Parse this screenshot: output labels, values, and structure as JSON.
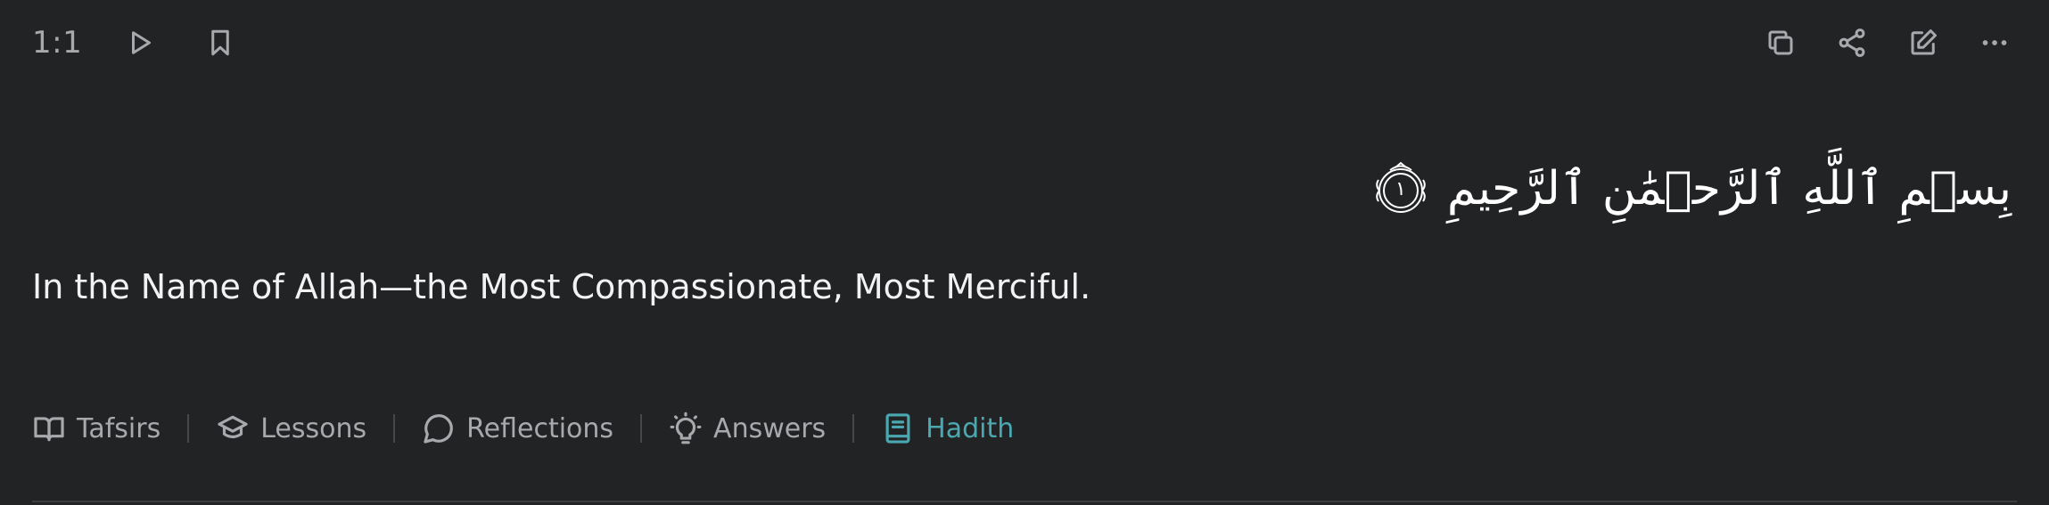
{
  "verse": {
    "key": "1:1",
    "arabic_text": "بِسۡمِ ٱللَّهِ ٱلرَّحۡمَٰنِ ٱلرَّحِيمِ",
    "ayah_number": "١",
    "translation": "In the Name of Allah—the Most Compassionate, Most Merciful."
  },
  "toolbar": {
    "play_icon": "play-icon",
    "bookmark_icon": "bookmark-icon",
    "copy_icon": "copy-icon",
    "share_icon": "share-icon",
    "edit_icon": "edit-icon",
    "more_icon": "more-icon"
  },
  "tabs": [
    {
      "label": "Tafsirs",
      "icon": "book-open-icon",
      "active": false
    },
    {
      "label": "Lessons",
      "icon": "graduation-cap-icon",
      "active": false
    },
    {
      "label": "Reflections",
      "icon": "chat-bubble-icon",
      "active": false
    },
    {
      "label": "Answers",
      "icon": "lightbulb-icon",
      "active": false
    },
    {
      "label": "Hadith",
      "icon": "book-icon",
      "active": true
    }
  ],
  "colors": {
    "background": "#222325",
    "muted": "#a7a9ad",
    "accent": "#4aa9b0",
    "text": "#f2f2f2"
  }
}
